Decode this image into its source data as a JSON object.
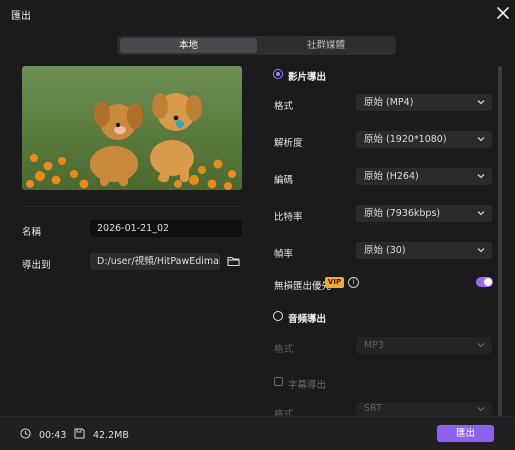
{
  "window": {
    "title": "匯出"
  },
  "tabs": {
    "local": "本地",
    "social": "社群媒體"
  },
  "left": {
    "name_label": "名稱",
    "name_value": "2026-01-21_02",
    "export_to_label": "導出到",
    "export_path": "D:/user/視頻/HitPawEdimakor"
  },
  "video": {
    "section_label": "影片導出",
    "format_label": "格式",
    "format_value": "原始 (MP4)",
    "resolution_label": "解析度",
    "resolution_value": "原始 (1920*1080)",
    "codec_label": "編碼",
    "codec_value": "原始 (H264)",
    "bitrate_label": "比特率",
    "bitrate_value": "原始 (7936kbps)",
    "framerate_label": "幀率",
    "framerate_value": "原始 (30)",
    "lossless_label": "無損匯出優先",
    "vip_badge": "VIP",
    "lossless_enabled": true
  },
  "audio": {
    "section_label": "音頻導出",
    "format_label": "格式",
    "format_value": "MP3"
  },
  "subtitle": {
    "label": "字幕導出",
    "format_label": "格式",
    "format_value": "SRT"
  },
  "footer": {
    "duration": "00:43",
    "size": "42.2MB",
    "export_button": "匯出"
  },
  "colors": {
    "accent": "#8f5ff0",
    "vip": "#f2a73a",
    "background": "#1b1b1d"
  }
}
